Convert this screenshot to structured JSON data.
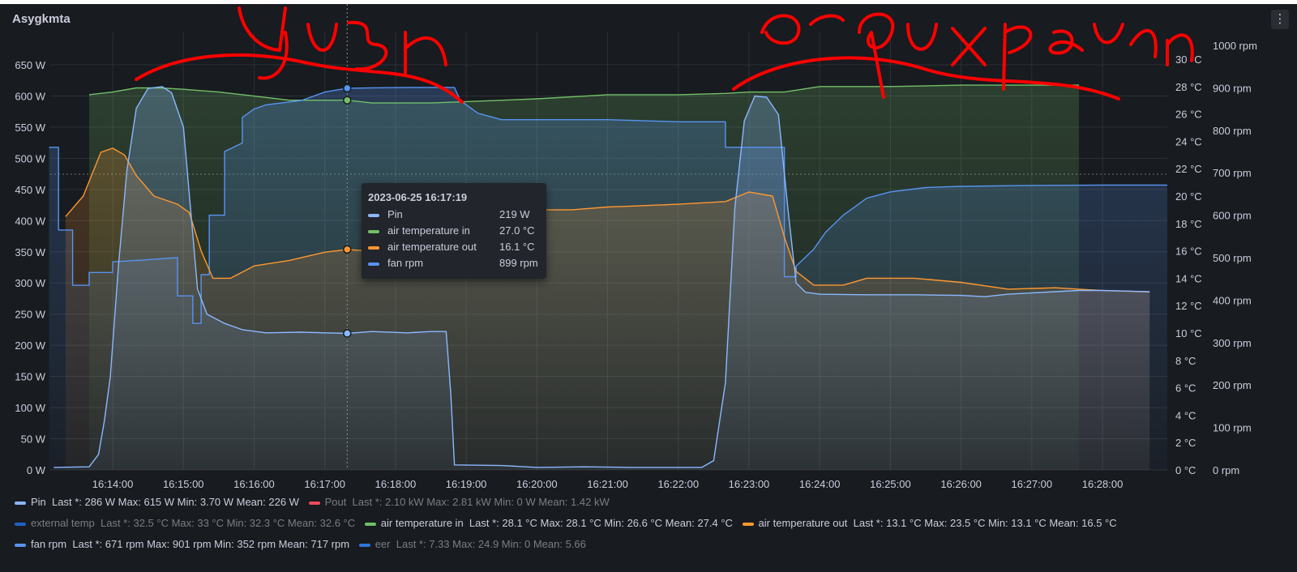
{
  "panel": {
    "title": "Asygkmta",
    "menu_icon": "kebab-menu-icon"
  },
  "colors": {
    "background": "#181b1f",
    "pin": "#8ab8ff",
    "pout": "#f2495c",
    "external_temp": "#1f60c4",
    "air_in": "#73bf69",
    "air_out": "#ff9830",
    "fan_rpm": "#5794f2",
    "eer": "#3274d9",
    "annotation": "#ff0000"
  },
  "annotations": [
    "yuzn",
    "arqwixpavgn"
  ],
  "tooltip": {
    "time": "2023-06-25 16:17:19",
    "rows": [
      {
        "name": "Pin",
        "value": "219 W",
        "color": "#8ab8ff"
      },
      {
        "name": "air temperature in",
        "value": "27.0 °C",
        "color": "#73bf69"
      },
      {
        "name": "air temperature out",
        "value": "16.1 °C",
        "color": "#ff9830"
      },
      {
        "name": "fan rpm",
        "value": "899 rpm",
        "color": "#5794f2"
      }
    ]
  },
  "legend": [
    {
      "name": "Pin",
      "stats": "Last *: 286 W  Max: 615 W  Min: 3.70 W  Mean: 226 W",
      "color": "#8ab8ff",
      "dim": false
    },
    {
      "name": "Pout",
      "stats": "Last *: 2.10 kW  Max: 2.81 kW  Min: 0 W  Mean: 1.42 kW",
      "color": "#f2495c",
      "dim": true
    },
    {
      "name": "external temp",
      "stats": "Last *: 32.5 °C  Max: 33 °C  Min: 32.3 °C  Mean: 32.6 °C",
      "color": "#1f60c4",
      "dim": true
    },
    {
      "name": "air temperature in",
      "stats": "Last *: 28.1 °C  Max: 28.1 °C  Min: 26.6 °C  Mean: 27.4 °C",
      "color": "#73bf69",
      "dim": false
    },
    {
      "name": "air temperature out",
      "stats": "Last *: 13.1 °C  Max: 23.5 °C  Min: 13.1 °C  Mean: 16.5 °C",
      "color": "#ff9830",
      "dim": false
    },
    {
      "name": "fan rpm",
      "stats": "Last *: 671 rpm  Max: 901 rpm  Min: 352 rpm  Mean: 717 rpm",
      "color": "#5794f2",
      "dim": false
    },
    {
      "name": "eer",
      "stats": "Last *: 7.33  Max: 24.9  Min: 0  Mean: 5.66",
      "color": "#3274d9",
      "dim": true
    }
  ],
  "chart_data": {
    "type": "line",
    "hover_time": "16:17:19",
    "x_ticks": [
      "16:14:00",
      "16:15:00",
      "16:16:00",
      "16:17:00",
      "16:18:00",
      "16:19:00",
      "16:20:00",
      "16:21:00",
      "16:22:00",
      "16:23:00",
      "16:24:00",
      "16:25:00",
      "16:26:00",
      "16:27:00",
      "16:28:00"
    ],
    "y_left": {
      "unit": "W",
      "range": [
        0,
        700
      ],
      "ticks": [
        "0 W",
        "50 W",
        "100 W",
        "150 W",
        "200 W",
        "250 W",
        "300 W",
        "350 W",
        "400 W",
        "450 W",
        "500 W",
        "550 W",
        "600 W",
        "650 W"
      ]
    },
    "y_temp": {
      "unit": "°C",
      "range": [
        0,
        32
      ],
      "ticks": [
        "0 °C",
        "2 °C",
        "4 °C",
        "6 °C",
        "8 °C",
        "10 °C",
        "12 °C",
        "14 °C",
        "16 °C",
        "18 °C",
        "20 °C",
        "22 °C",
        "24 °C",
        "26 °C",
        "28 °C",
        "30 °C"
      ]
    },
    "y_rpm": {
      "unit": "rpm",
      "range": [
        0,
        1000
      ],
      "ticks": [
        "0 rpm",
        "100 rpm",
        "200 rpm",
        "300 rpm",
        "400 rpm",
        "500 rpm",
        "600 rpm",
        "700 rpm",
        "800 rpm",
        "900 rpm",
        "1000 rpm"
      ]
    },
    "series": [
      {
        "name": "Pin",
        "axis": "y_left",
        "color": "#8ab8ff",
        "points": [
          [
            "16:13:10",
            4
          ],
          [
            "16:13:40",
            5
          ],
          [
            "16:13:48",
            25
          ],
          [
            "16:13:53",
            80
          ],
          [
            "16:13:58",
            150
          ],
          [
            "16:14:05",
            330
          ],
          [
            "16:14:12",
            480
          ],
          [
            "16:14:20",
            580
          ],
          [
            "16:14:30",
            612
          ],
          [
            "16:14:42",
            615
          ],
          [
            "16:14:50",
            605
          ],
          [
            "16:15:00",
            550
          ],
          [
            "16:15:06",
            420
          ],
          [
            "16:15:12",
            290
          ],
          [
            "16:15:20",
            250
          ],
          [
            "16:15:35",
            235
          ],
          [
            "16:15:50",
            225
          ],
          [
            "16:16:10",
            220
          ],
          [
            "16:16:40",
            221
          ],
          [
            "16:17:00",
            220
          ],
          [
            "16:17:19",
            219
          ],
          [
            "16:17:40",
            222
          ],
          [
            "16:18:10",
            220
          ],
          [
            "16:18:30",
            222
          ],
          [
            "16:18:43",
            222
          ],
          [
            "16:18:47",
            120
          ],
          [
            "16:18:50",
            8
          ],
          [
            "16:19:30",
            7
          ],
          [
            "16:20:00",
            4
          ],
          [
            "16:20:40",
            5
          ],
          [
            "16:21:20",
            4
          ],
          [
            "16:22:00",
            4
          ],
          [
            "16:22:20",
            4
          ],
          [
            "16:22:30",
            15
          ],
          [
            "16:22:40",
            140
          ],
          [
            "16:22:48",
            420
          ],
          [
            "16:22:56",
            560
          ],
          [
            "16:23:05",
            600
          ],
          [
            "16:23:15",
            598
          ],
          [
            "16:23:25",
            570
          ],
          [
            "16:23:33",
            420
          ],
          [
            "16:23:40",
            300
          ],
          [
            "16:23:48",
            285
          ],
          [
            "16:24:00",
            282
          ],
          [
            "16:24:40",
            281
          ],
          [
            "16:25:20",
            281
          ],
          [
            "16:26:00",
            280
          ],
          [
            "16:26:20",
            278
          ],
          [
            "16:26:40",
            282
          ],
          [
            "16:27:20",
            286
          ],
          [
            "16:27:40",
            288
          ],
          [
            "16:28:00",
            288
          ],
          [
            "16:28:40",
            286
          ]
        ]
      },
      {
        "name": "air temperature in",
        "axis": "y_temp",
        "color": "#73bf69",
        "points": [
          [
            "16:13:40",
            27.4
          ],
          [
            "16:14:00",
            27.6
          ],
          [
            "16:14:20",
            27.9
          ],
          [
            "16:14:40",
            27.9
          ],
          [
            "16:15:00",
            27.8
          ],
          [
            "16:15:30",
            27.6
          ],
          [
            "16:16:00",
            27.3
          ],
          [
            "16:16:30",
            27.0
          ],
          [
            "16:17:00",
            27.0
          ],
          [
            "16:17:19",
            27.0
          ],
          [
            "16:17:40",
            26.8
          ],
          [
            "16:18:30",
            26.8
          ],
          [
            "16:19:00",
            26.9
          ],
          [
            "16:20:00",
            27.1
          ],
          [
            "16:21:00",
            27.4
          ],
          [
            "16:21:30",
            27.4
          ],
          [
            "16:22:00",
            27.4
          ],
          [
            "16:22:40",
            27.5
          ],
          [
            "16:23:00",
            27.6
          ],
          [
            "16:23:30",
            27.6
          ],
          [
            "16:24:00",
            28.0
          ],
          [
            "16:25:00",
            28.0
          ],
          [
            "16:26:00",
            28.1
          ],
          [
            "16:27:00",
            28.1
          ],
          [
            "16:27:40",
            28.1
          ]
        ]
      },
      {
        "name": "air temperature out",
        "axis": "y_temp",
        "color": "#ff9830",
        "points": [
          [
            "16:13:20",
            18.5
          ],
          [
            "16:13:35",
            20.0
          ],
          [
            "16:13:50",
            23.2
          ],
          [
            "16:14:00",
            23.5
          ],
          [
            "16:14:10",
            23.0
          ],
          [
            "16:14:20",
            21.5
          ],
          [
            "16:14:35",
            20.0
          ],
          [
            "16:14:55",
            19.4
          ],
          [
            "16:15:05",
            18.8
          ],
          [
            "16:15:15",
            16.0
          ],
          [
            "16:15:25",
            14.0
          ],
          [
            "16:15:40",
            14.0
          ],
          [
            "16:16:00",
            14.9
          ],
          [
            "16:16:30",
            15.3
          ],
          [
            "16:17:00",
            15.9
          ],
          [
            "16:17:19",
            16.1
          ],
          [
            "16:17:35",
            16.0
          ],
          [
            "16:18:00",
            18.0
          ],
          [
            "16:18:40",
            18.8
          ],
          [
            "16:19:40",
            19.0
          ],
          [
            "16:20:30",
            19.0
          ],
          [
            "16:21:00",
            19.2
          ],
          [
            "16:22:00",
            19.4
          ],
          [
            "16:22:40",
            19.6
          ],
          [
            "16:23:00",
            20.3
          ],
          [
            "16:23:20",
            20.0
          ],
          [
            "16:23:30",
            17.0
          ],
          [
            "16:23:40",
            14.5
          ],
          [
            "16:23:55",
            13.5
          ],
          [
            "16:24:20",
            13.5
          ],
          [
            "16:24:40",
            14.0
          ],
          [
            "16:25:20",
            14.0
          ],
          [
            "16:26:00",
            13.7
          ],
          [
            "16:26:40",
            13.2
          ],
          [
            "16:27:20",
            13.3
          ],
          [
            "16:27:40",
            13.2
          ],
          [
            "16:28:00",
            13.1
          ],
          [
            "16:28:40",
            13.0
          ]
        ]
      },
      {
        "name": "fan rpm",
        "axis": "y_rpm",
        "color": "#5794f2",
        "points": [
          [
            "16:13:06",
            760
          ],
          [
            "16:13:14",
            760
          ],
          [
            "16:13:14",
            565
          ],
          [
            "16:13:26",
            565
          ],
          [
            "16:13:26",
            435
          ],
          [
            "16:13:40",
            435
          ],
          [
            "16:13:40",
            465
          ],
          [
            "16:14:00",
            465
          ],
          [
            "16:14:00",
            490
          ],
          [
            "16:14:30",
            495
          ],
          [
            "16:14:55",
            500
          ],
          [
            "16:14:55",
            410
          ],
          [
            "16:15:08",
            410
          ],
          [
            "16:15:08",
            345
          ],
          [
            "16:15:15",
            345
          ],
          [
            "16:15:15",
            460
          ],
          [
            "16:15:22",
            460
          ],
          [
            "16:15:22",
            600
          ],
          [
            "16:15:35",
            600
          ],
          [
            "16:15:35",
            750
          ],
          [
            "16:15:50",
            770
          ],
          [
            "16:15:50",
            830
          ],
          [
            "16:16:00",
            850
          ],
          [
            "16:16:10",
            860
          ],
          [
            "16:16:40",
            870
          ],
          [
            "16:17:00",
            890
          ],
          [
            "16:17:19",
            899
          ],
          [
            "16:17:40",
            900
          ],
          [
            "16:18:10",
            901
          ],
          [
            "16:18:30",
            901
          ],
          [
            "16:18:50",
            901
          ],
          [
            "16:18:55",
            870
          ],
          [
            "16:19:10",
            840
          ],
          [
            "16:19:30",
            825
          ],
          [
            "16:20:00",
            825
          ],
          [
            "16:21:00",
            825
          ],
          [
            "16:22:00",
            820
          ],
          [
            "16:22:40",
            820
          ],
          [
            "16:22:40",
            760
          ],
          [
            "16:23:30",
            760
          ],
          [
            "16:23:30",
            455
          ],
          [
            "16:23:40",
            455
          ],
          [
            "16:23:40",
            480
          ],
          [
            "16:23:55",
            520
          ],
          [
            "16:24:05",
            560
          ],
          [
            "16:24:20",
            600
          ],
          [
            "16:24:40",
            640
          ],
          [
            "16:25:00",
            655
          ],
          [
            "16:25:30",
            665
          ],
          [
            "16:26:00",
            668
          ],
          [
            "16:27:00",
            670
          ],
          [
            "16:28:00",
            671
          ],
          [
            "16:28:55",
            671
          ]
        ]
      }
    ]
  }
}
